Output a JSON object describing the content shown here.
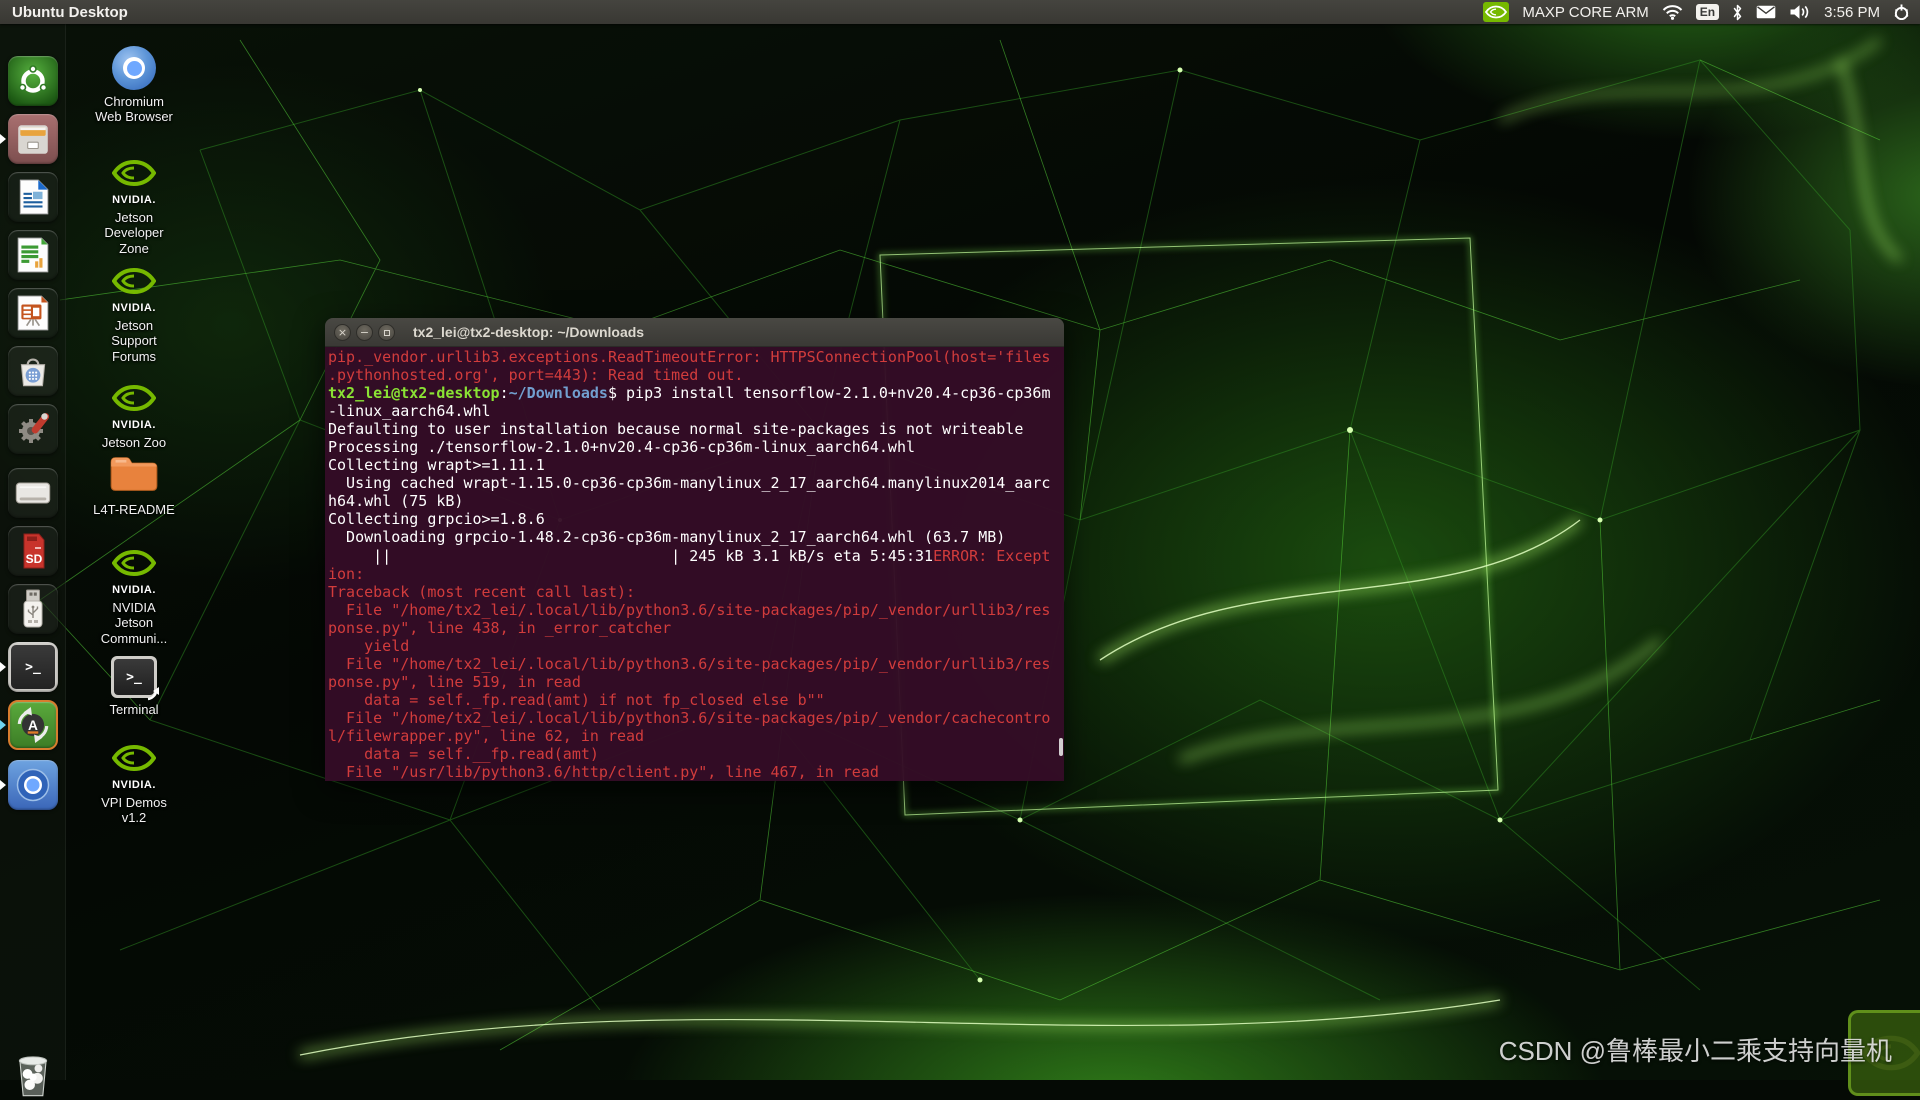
{
  "panel": {
    "title": "Ubuntu Desktop",
    "status": "MAXP CORE ARM",
    "keyboard": "En",
    "time": "3:56 PM"
  },
  "colors": {
    "nvidia_green": "#76b900",
    "terminal_bg": "#340c27",
    "terminal_red": "#d23c3c",
    "prompt_green": "#8ae234",
    "path_blue": "#729fcf",
    "panel_gray": "#3c3b37"
  },
  "dock": {
    "items": [
      {
        "name": "dash-home",
        "type": "dash"
      },
      {
        "name": "files",
        "type": "files",
        "arrow": "white"
      },
      {
        "name": "libreoffice-writer",
        "type": "writer"
      },
      {
        "name": "libreoffice-calc",
        "type": "calc"
      },
      {
        "name": "libreoffice-impress",
        "type": "impress"
      },
      {
        "name": "ubuntu-software",
        "type": "soft"
      },
      {
        "name": "system-settings",
        "type": "gear"
      },
      {
        "name": "disks",
        "type": "disk"
      },
      {
        "name": "sd-card",
        "type": "sd",
        "label": "SD"
      },
      {
        "name": "usb-drive",
        "type": "usb"
      },
      {
        "name": "terminal",
        "type": "term",
        "arrow": "white",
        "glyph": ">_"
      },
      {
        "name": "software-updater",
        "type": "upd",
        "arrow": "cyan",
        "glyph": "A"
      },
      {
        "name": "chromium",
        "type": "chrome",
        "arrow": "white"
      }
    ],
    "trash": {
      "name": "trash",
      "type": "trash"
    }
  },
  "desktop": {
    "icons": [
      {
        "name": "chromium-web-browser",
        "type": "chromium",
        "label": "Chromium Web Browser"
      },
      {
        "name": "jetson-developer-zone",
        "type": "nvidia",
        "label": "Jetson Developer Zone",
        "wordmark": "NVIDIA."
      },
      {
        "name": "jetson-support-forums",
        "type": "nvidia",
        "label": "Jetson Support Forums",
        "wordmark": "NVIDIA."
      },
      {
        "name": "jetson-zoo",
        "type": "nvidia",
        "label": "Jetson Zoo",
        "wordmark": "NVIDIA."
      },
      {
        "name": "l4t-readme",
        "type": "folder",
        "label": "L4T-README"
      },
      {
        "name": "nvidia-jetson-community",
        "type": "nvidia",
        "label": "NVIDIA Jetson Communi...",
        "wordmark": "NVIDIA."
      },
      {
        "name": "terminal",
        "type": "terminal",
        "label": "Terminal",
        "glyph": ">_"
      },
      {
        "name": "vpi-demos",
        "type": "nvidia",
        "label": "VPI Demos v1.2",
        "wordmark": "NVIDIA."
      }
    ]
  },
  "terminal": {
    "title": "tx2_lei@tx2-desktop: ~/Downloads",
    "lines": [
      {
        "s": [
          {
            "t": "pip._vendor.urllib3.exceptions.ReadTimeoutError: HTTPSConnectionPool(host='files",
            "c": "red"
          }
        ]
      },
      {
        "s": [
          {
            "t": ".pythonhosted.org', port=443): Read timed out.",
            "c": "red"
          }
        ]
      },
      {
        "s": [
          {
            "t": "tx2_lei@tx2-desktop",
            "c": "green"
          },
          {
            "t": ":",
            "c": "fg"
          },
          {
            "t": "~/Downloads",
            "c": "blue"
          },
          {
            "t": "$ pip3 install tensorflow-2.1.0+nv20.4-cp36-cp36m",
            "c": "fg"
          }
        ]
      },
      {
        "s": [
          {
            "t": "-linux_aarch64.whl",
            "c": "fg"
          }
        ]
      },
      {
        "s": [
          {
            "t": "Defaulting to user installation because normal site-packages is not writeable",
            "c": "fg"
          }
        ]
      },
      {
        "s": [
          {
            "t": "Processing ./tensorflow-2.1.0+nv20.4-cp36-cp36m-linux_aarch64.whl",
            "c": "fg"
          }
        ]
      },
      {
        "s": [
          {
            "t": "Collecting wrapt>=1.11.1",
            "c": "fg"
          }
        ]
      },
      {
        "s": [
          {
            "t": "  Using cached wrapt-1.15.0-cp36-cp36m-manylinux_2_17_aarch64.manylinux2014_aarc",
            "c": "fg"
          }
        ]
      },
      {
        "s": [
          {
            "t": "h64.whl (75 kB)",
            "c": "fg"
          }
        ]
      },
      {
        "s": [
          {
            "t": "Collecting grpcio>=1.8.6",
            "c": "fg"
          }
        ]
      },
      {
        "s": [
          {
            "t": "  Downloading grpcio-1.48.2-cp36-cp36m-manylinux_2_17_aarch64.whl (63.7 MB)",
            "c": "fg"
          }
        ]
      },
      {
        "s": [
          {
            "t": "     ||                               | 245 kB 3.1 kB/s eta 5:45:31",
            "c": "fg"
          },
          {
            "t": "ERROR: Except",
            "c": "red"
          }
        ]
      },
      {
        "s": [
          {
            "t": "ion:",
            "c": "red"
          }
        ]
      },
      {
        "s": [
          {
            "t": "Traceback (most recent call last):",
            "c": "red"
          }
        ]
      },
      {
        "s": [
          {
            "t": "  File \"/home/tx2_lei/.local/lib/python3.6/site-packages/pip/_vendor/urllib3/res",
            "c": "red"
          }
        ]
      },
      {
        "s": [
          {
            "t": "ponse.py\", line 438, in _error_catcher",
            "c": "red"
          }
        ]
      },
      {
        "s": [
          {
            "t": "    yield",
            "c": "red"
          }
        ]
      },
      {
        "s": [
          {
            "t": "  File \"/home/tx2_lei/.local/lib/python3.6/site-packages/pip/_vendor/urllib3/res",
            "c": "red"
          }
        ]
      },
      {
        "s": [
          {
            "t": "ponse.py\", line 519, in read",
            "c": "red"
          }
        ]
      },
      {
        "s": [
          {
            "t": "    data = self._fp.read(amt) if not fp_closed else b\"\"",
            "c": "red"
          }
        ]
      },
      {
        "s": [
          {
            "t": "  File \"/home/tx2_lei/.local/lib/python3.6/site-packages/pip/_vendor/cachecontro",
            "c": "red"
          }
        ]
      },
      {
        "s": [
          {
            "t": "l/filewrapper.py\", line 62, in read",
            "c": "red"
          }
        ]
      },
      {
        "s": [
          {
            "t": "    data = self.__fp.read(amt)",
            "c": "red"
          }
        ]
      },
      {
        "s": [
          {
            "t": "  File \"/usr/lib/python3.6/http/client.py\", line 467, in read",
            "c": "red"
          }
        ]
      }
    ]
  },
  "watermark": {
    "text": "CSDN @鲁棒最小二乘支持向量机"
  }
}
